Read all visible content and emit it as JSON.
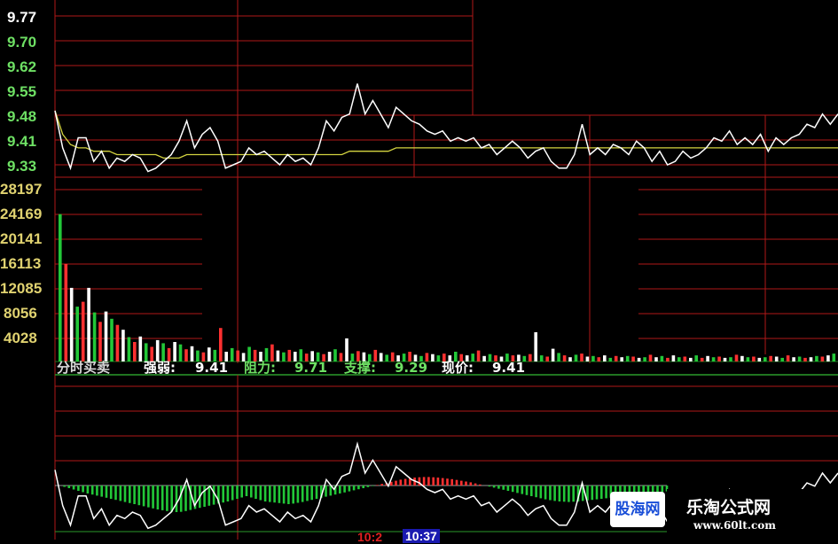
{
  "chart_data": [
    {
      "type": "line",
      "y_ticks": [
        "9.77",
        "9.70",
        "9.62",
        "9.55",
        "9.48",
        "9.41",
        "9.33"
      ],
      "ylim": [
        9.3,
        9.77
      ],
      "price": [
        9.49,
        9.38,
        9.32,
        9.41,
        9.41,
        9.34,
        9.37,
        9.32,
        9.35,
        9.34,
        9.36,
        9.35,
        9.31,
        9.32,
        9.34,
        9.36,
        9.4,
        9.46,
        9.38,
        9.42,
        9.44,
        9.4,
        9.32,
        9.33,
        9.34,
        9.38,
        9.36,
        9.37,
        9.35,
        9.33,
        9.36,
        9.34,
        9.35,
        9.33,
        9.38,
        9.46,
        9.43,
        9.47,
        9.48,
        9.57,
        9.48,
        9.52,
        9.48,
        9.44,
        9.5,
        9.48,
        9.46,
        9.45,
        9.43,
        9.42,
        9.43,
        9.4,
        9.41,
        9.4,
        9.41,
        9.38,
        9.39,
        9.36,
        9.38,
        9.4,
        9.38,
        9.35,
        9.37,
        9.38,
        9.34,
        9.32,
        9.32,
        9.36,
        9.45,
        9.36,
        9.38,
        9.36,
        9.39,
        9.38,
        9.36,
        9.4,
        9.38,
        9.34,
        9.37,
        9.33,
        9.34,
        9.37,
        9.35,
        9.36,
        9.38,
        9.41,
        9.4,
        9.43,
        9.39,
        9.41,
        9.39,
        9.42,
        9.37,
        9.41,
        9.39,
        9.41,
        9.42,
        9.45,
        9.44,
        9.48,
        9.45,
        9.48
      ],
      "avg": [
        9.49,
        9.42,
        9.39,
        9.38,
        9.38,
        9.37,
        9.37,
        9.37,
        9.36,
        9.36,
        9.36,
        9.36,
        9.36,
        9.36,
        9.35,
        9.35,
        9.35,
        9.36,
        9.36,
        9.36,
        9.36,
        9.36,
        9.36,
        9.36,
        9.36,
        9.36,
        9.36,
        9.36,
        9.36,
        9.36,
        9.36,
        9.36,
        9.36,
        9.36,
        9.36,
        9.36,
        9.36,
        9.36,
        9.37,
        9.37,
        9.37,
        9.37,
        9.37,
        9.37,
        9.38,
        9.38,
        9.38,
        9.38,
        9.38,
        9.38,
        9.38,
        9.38,
        9.38,
        9.38,
        9.38,
        9.38,
        9.38,
        9.38,
        9.38,
        9.38,
        9.38,
        9.38,
        9.38,
        9.38,
        9.38,
        9.38,
        9.38,
        9.38,
        9.38,
        9.38,
        9.38,
        9.38,
        9.38,
        9.38,
        9.38,
        9.38,
        9.38,
        9.38,
        9.38,
        9.38,
        9.38,
        9.38,
        9.38,
        9.38,
        9.38,
        9.38,
        9.38,
        9.38,
        9.38,
        9.38,
        9.38,
        9.38,
        9.38,
        9.38,
        9.38,
        9.38,
        9.38,
        9.38,
        9.38,
        9.38,
        9.38,
        9.38
      ]
    },
    {
      "type": "bar",
      "y_ticks": [
        "28197",
        "24169",
        "20141",
        "16113",
        "12085",
        "8056",
        "4028"
      ],
      "ylim": [
        0,
        28197
      ],
      "volume": [
        24169,
        16000,
        12085,
        9000,
        9800,
        12085,
        8056,
        6500,
        8200,
        7000,
        6000,
        5200,
        4000,
        3200,
        4100,
        3000,
        2400,
        3500,
        3000,
        2200,
        3200,
        2800,
        2000,
        2500,
        1800,
        1500,
        2300,
        1900,
        5500,
        1600,
        2200,
        1800,
        1400,
        2400,
        1900,
        1600,
        2200,
        2800,
        1800,
        1500,
        1900,
        1600,
        2000,
        1300,
        1700,
        1500,
        1200,
        1600,
        2000,
        1400,
        3800,
        1300,
        1700,
        1500,
        1200,
        1900,
        1400,
        1100,
        1500,
        1000,
        1300,
        1600,
        1100,
        900,
        1400,
        1200,
        1000,
        1300,
        1000,
        1600,
        1200,
        1000,
        1300,
        1800,
        900,
        1200,
        1000,
        800,
        1300,
        1000,
        1100,
        900,
        1200,
        4800,
        1000,
        800,
        2100,
        1400,
        1000,
        700,
        1100,
        1300,
        800,
        900,
        700,
        1000,
        600,
        900,
        700,
        900,
        800,
        600,
        700,
        1100,
        700,
        900,
        600,
        1000,
        700,
        800,
        600,
        1000,
        600,
        900,
        700,
        800,
        600,
        700,
        1100,
        900,
        700,
        800,
        600,
        700,
        900,
        800,
        600,
        1000,
        700,
        800,
        600,
        700,
        900,
        800,
        1000,
        1300
      ]
    },
    {
      "type": "bar",
      "indicator_title": "分时买卖",
      "labels": {
        "strength": "强弱:",
        "resistance": "阻力:",
        "support": "支撑:",
        "price": "现价:"
      },
      "values": {
        "strength": "9.41",
        "resistance": "9.71",
        "support": "9.29",
        "price": "9.41"
      },
      "osc": [
        0.0,
        -0.05,
        -0.1,
        -0.15,
        -0.2,
        -0.25,
        -0.3,
        -0.34,
        -0.38,
        -0.42,
        -0.46,
        -0.5,
        -0.54,
        -0.58,
        -0.62,
        -0.66,
        -0.7,
        -0.74,
        -0.78,
        -0.82,
        -0.86,
        -0.9,
        -0.93,
        -0.96,
        -0.99,
        -1.0,
        -0.99,
        -0.96,
        -0.92,
        -0.88,
        -0.84,
        -0.8,
        -0.76,
        -0.72,
        -0.68,
        -0.64,
        -0.6,
        -0.55,
        -0.5,
        -0.45,
        -0.4,
        -0.45,
        -0.5,
        -0.55,
        -0.6,
        -0.62,
        -0.64,
        -0.66,
        -0.68,
        -0.7,
        -0.68,
        -0.65,
        -0.62,
        -0.58,
        -0.54,
        -0.5,
        -0.46,
        -0.42,
        -0.38,
        -0.34,
        -0.3,
        -0.26,
        -0.22,
        -0.18,
        -0.14,
        -0.1,
        -0.06,
        -0.02,
        0.02,
        0.06,
        0.1,
        0.14,
        0.18,
        0.22,
        0.25,
        0.28,
        0.3,
        0.31,
        0.32,
        0.32,
        0.31,
        0.3,
        0.28,
        0.26,
        0.24,
        0.21,
        0.18,
        0.15,
        0.12,
        0.08,
        0.04,
        0.0,
        -0.04,
        -0.08,
        -0.12,
        -0.16,
        -0.2,
        -0.24,
        -0.28,
        -0.32,
        -0.36,
        -0.4,
        -0.44,
        -0.48,
        -0.52,
        -0.55,
        -0.58,
        -0.6,
        -0.61,
        -0.62,
        -0.61,
        -0.6,
        -0.58,
        -0.56,
        -0.54,
        -0.52,
        -0.5,
        -0.48,
        -0.46,
        -0.44,
        -0.42,
        -0.4,
        -0.38,
        -0.36,
        -0.34,
        -0.32,
        -0.3,
        -0.28,
        -0.26,
        -0.24,
        -0.22
      ]
    }
  ],
  "times": {
    "t1": "10:2",
    "t2": "10:37"
  },
  "watermark": {
    "site_short": "股海网",
    "site_name": "乐淘公式网",
    "url": "www.60lt.com"
  },
  "colors": {
    "grid": "#b01818",
    "up": "#ff3030",
    "down": "#22c838",
    "price_line": "#ffffff",
    "avg_line": "#d4d440",
    "tick_top": "#ffffff",
    "tick_green": "#6ee064",
    "tick_vol": "#e0d270"
  }
}
